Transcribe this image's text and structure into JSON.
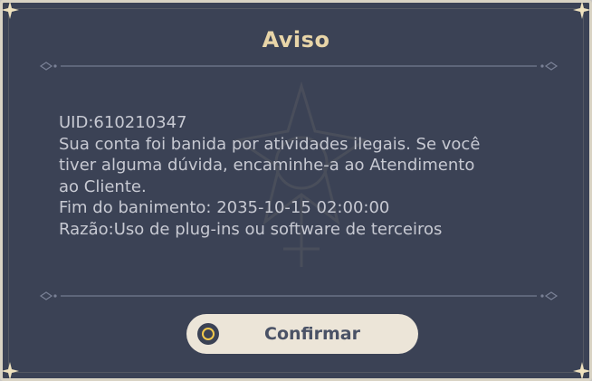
{
  "dialog": {
    "title": "Aviso",
    "message": {
      "uid": "UID:610210347",
      "line1": "Sua conta foi banida por atividades ilegais. Se você",
      "line2": "tiver alguma dúvida, encaminhe-a ao Atendimento",
      "line3": "ao Cliente.",
      "ban_end": "Fim do banimento: 2035-10-15 02:00:00",
      "reason": "Razão:Uso de plug-ins ou software de terceiros"
    },
    "confirm_label": "Confirmar"
  },
  "icons": {
    "confirm": "circle-icon",
    "corner": "star-corner-icon",
    "divider": "ornament-divider-icon"
  },
  "colors": {
    "panel_bg": "#3b4255",
    "title_text": "#e8d5a8",
    "body_text": "#c7c9d2",
    "button_bg": "#ece5d8",
    "button_text": "#4a5266",
    "accent": "#f2c94c"
  }
}
